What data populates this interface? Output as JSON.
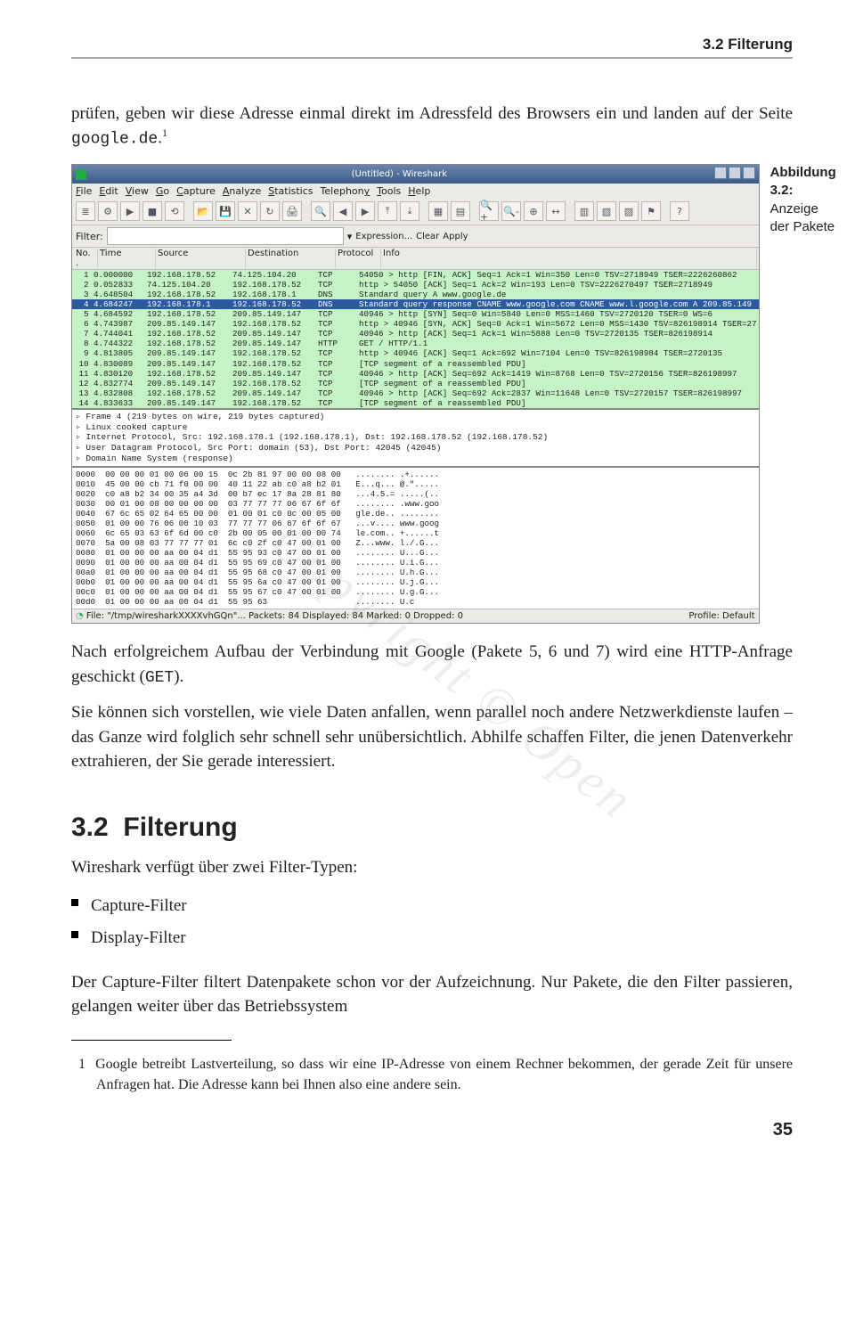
{
  "header": {
    "running": "3.2 Filterung"
  },
  "para1_a": "prüfen, geben wir diese Adresse einmal direkt im Adressfeld des Browsers ein und landen auf der Seite ",
  "para1_mono": "google.de",
  "para1_b": ".",
  "para1_sup": "1",
  "caption": {
    "bold": "Abbildung 3.2:",
    "rest": "Anzeige der Pakete"
  },
  "wireshark": {
    "title": "(Untitled) - Wireshark",
    "menu": [
      "File",
      "Edit",
      "View",
      "Go",
      "Capture",
      "Analyze",
      "Statistics",
      "Telephony",
      "Tools",
      "Help"
    ],
    "filter_label": "Filter:",
    "filter_btns": [
      "Expression...",
      "Clear",
      "Apply"
    ],
    "columns": [
      "No. .",
      "Time",
      "Source",
      "Destination",
      "Protocol",
      "Info"
    ],
    "packets": [
      {
        "no": "1",
        "t": "0.000000",
        "s": "192.168.178.52",
        "d": "74.125.104.20",
        "p": "TCP",
        "i": "54050 > http [FIN, ACK] Seq=1 Ack=1 Win=350 Len=0 TSV=2718949 TSER=2226260862"
      },
      {
        "no": "2",
        "t": "0.052833",
        "s": "74.125.104.20",
        "d": "192.168.178.52",
        "p": "TCP",
        "i": "http > 54050 [ACK] Seq=1 Ack=2 Win=193 Len=0 TSV=2226270497 TSER=2718949"
      },
      {
        "no": "3",
        "t": "4.648504",
        "s": "192.168.178.52",
        "d": "192.168.178.1",
        "p": "DNS",
        "i": "Standard query A www.google.de"
      },
      {
        "no": "4",
        "t": "4.684247",
        "s": "192.168.178.1",
        "d": "192.168.178.52",
        "p": "DNS",
        "i": "Standard query response CNAME www.google.com CNAME www.l.google.com A 209.85.149",
        "sel": true
      },
      {
        "no": "5",
        "t": "4.684592",
        "s": "192.168.178.52",
        "d": "209.85.149.147",
        "p": "TCP",
        "i": "40946 > http [SYN] Seq=0 Win=5840 Len=0 MSS=1460 TSV=2720120 TSER=0 WS=6"
      },
      {
        "no": "6",
        "t": "4.743987",
        "s": "209.85.149.147",
        "d": "192.168.178.52",
        "p": "TCP",
        "i": "http > 40946 [SYN, ACK] Seq=0 Ack=1 Win=5672 Len=0 MSS=1430 TSV=826198914 TSER=27"
      },
      {
        "no": "7",
        "t": "4.744041",
        "s": "192.168.178.52",
        "d": "209.85.149.147",
        "p": "TCP",
        "i": "40946 > http [ACK] Seq=1 Ack=1 Win=5888 Len=0 TSV=2720135 TSER=826198914"
      },
      {
        "no": "8",
        "t": "4.744322",
        "s": "192.168.178.52",
        "d": "209.85.149.147",
        "p": "HTTP",
        "i": "GET / HTTP/1.1"
      },
      {
        "no": "9",
        "t": "4.813805",
        "s": "209.85.149.147",
        "d": "192.168.178.52",
        "p": "TCP",
        "i": "http > 40946 [ACK] Seq=1 Ack=692 Win=7104 Len=0 TSV=826198984 TSER=2720135"
      },
      {
        "no": "10",
        "t": "4.830089",
        "s": "209.85.149.147",
        "d": "192.168.178.52",
        "p": "TCP",
        "i": "[TCP segment of a reassembled PDU]"
      },
      {
        "no": "11",
        "t": "4.830120",
        "s": "192.168.178.52",
        "d": "209.85.149.147",
        "p": "TCP",
        "i": "40946 > http [ACK] Seq=692 Ack=1419 Win=8768 Len=0 TSV=2720156 TSER=826198997"
      },
      {
        "no": "12",
        "t": "4.832774",
        "s": "209.85.149.147",
        "d": "192.168.178.52",
        "p": "TCP",
        "i": "[TCP segment of a reassembled PDU]"
      },
      {
        "no": "13",
        "t": "4.832808",
        "s": "192.168.178.52",
        "d": "209.85.149.147",
        "p": "TCP",
        "i": "40946 > http [ACK] Seq=692 Ack=2837 Win=11648 Len=0 TSV=2720157 TSER=826198997"
      },
      {
        "no": "14",
        "t": "4.833633",
        "s": "209.85.149.147",
        "d": "192.168.178.52",
        "p": "TCP",
        "i": "[TCP segment of a reassembled PDU]"
      }
    ],
    "tree": [
      "Frame 4 (219 bytes on wire, 219 bytes captured)",
      "Linux cooked capture",
      "Internet Protocol, Src: 192.168.178.1 (192.168.178.1), Dst: 192.168.178.52 (192.168.178.52)",
      "User Datagram Protocol, Src Port: domain (53), Dst Port: 42045 (42045)",
      "Domain Name System (response)"
    ],
    "hex": "0000  00 00 00 01 00 06 00 15  0c 2b 81 97 00 00 08 00   ........ .+......\n0010  45 00 00 cb 71 f0 00 00  40 11 22 ab c0 a8 b2 01   E...q... @.\".....\n0020  c0 a8 b2 34 00 35 a4 3d  00 b7 ec 17 8a 28 81 80   ...4.5.= .....(..\n0030  00 01 00 08 00 00 00 00  03 77 77 77 06 67 6f 6f   ........ .www.goo\n0040  67 6c 65 02 64 65 00 00  01 00 01 c0 0c 00 05 00   gle.de.. ........\n0050  01 00 00 76 06 00 10 03  77 77 77 06 67 6f 6f 67   ...v.... www.goog\n0060  6c 65 03 63 6f 6d 00 c0  2b 00 05 00 01 00 00 74   le.com.. +......t\n0070  5a 00 08 03 77 77 77 01  6c c0 2f c0 47 00 01 00   Z...www. l./.G...\n0080  01 00 00 00 aa 00 04 d1  55 95 93 c0 47 00 01 00   ........ U...G...\n0090  01 00 00 00 aa 00 04 d1  55 95 69 c0 47 00 01 00   ........ U.i.G...\n00a0  01 00 00 00 aa 00 04 d1  55 95 68 c0 47 00 01 00   ........ U.h.G...\n00b0  01 00 00 00 aa 00 04 d1  55 95 6a c0 47 00 01 00   ........ U.j.G...\n00c0  01 00 00 00 aa 00 04 d1  55 95 67 c0 47 00 01 00   ........ U.g.G...\n00d0  01 00 00 00 aa 00 04 d1  55 95 63                  ........ U.c",
    "status_left": "File: \"/tmp/wiresharkXXXXvhGQn\"...   Packets: 84 Displayed: 84 Marked: 0 Dropped: 0",
    "status_right": "Profile: Default"
  },
  "para2_a": "Nach erfolgreichem Aufbau der Verbindung mit Google (Pakete 5, 6 und 7) wird eine HTTP-Anfrage geschickt (",
  "para2_mono": "GET",
  "para2_b": ").",
  "para3": "Sie können sich vorstellen, wie viele Daten anfallen, wenn parallel noch andere Netzwerkdienste laufen – das Ganze wird folglich sehr schnell sehr unübersichtlich. Abhilfe schaffen Filter, die jenen Datenverkehr extrahieren, der Sie gerade interessiert.",
  "section": {
    "num": "3.2",
    "title": "Filterung"
  },
  "para4": "Wireshark verfügt über zwei Filter-Typen:",
  "bullets": [
    "Capture-Filter",
    "Display-Filter"
  ],
  "para5": "Der Capture-Filter filtert Datenpakete schon vor der Aufzeichnung. Nur Pakete, die den Filter passieren, gelangen weiter über das Betriebssystem",
  "footnote": {
    "num": "1",
    "text": "Google betreibt Lastverteilung, so dass wir eine IP-Adresse von einem Rechner bekommen, der gerade Zeit für unsere Anfragen hat. Die Adresse kann bei Ihnen also eine andere sein."
  },
  "watermark": "Copyright   ©   Open",
  "pagenum": "35"
}
